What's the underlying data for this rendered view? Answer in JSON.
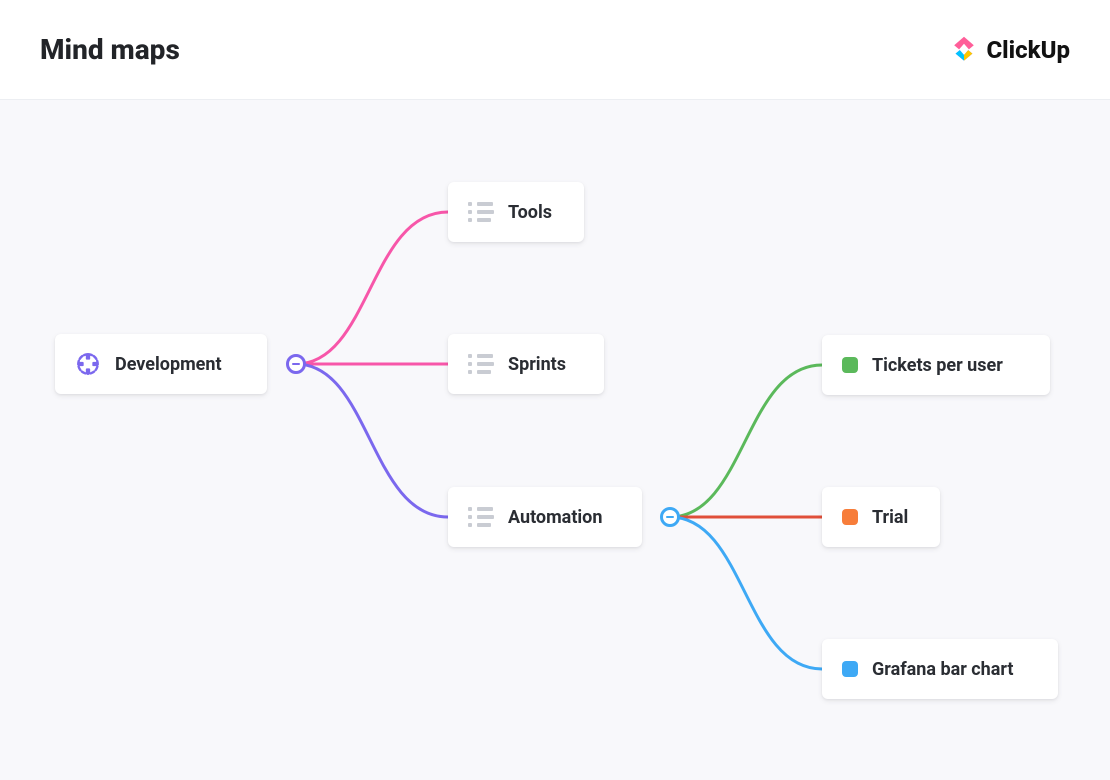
{
  "header": {
    "title": "Mind maps",
    "brand": "ClickUp"
  },
  "colors": {
    "purple": "#7b68ee",
    "pink": "#f756a9",
    "blue": "#3ea9f5",
    "green": "#5bb95b",
    "red": "#e04f3a",
    "orange": "#f77d3a"
  },
  "nodes": {
    "root": {
      "label": "Development",
      "icon": "globe-icon"
    },
    "level1": [
      {
        "id": "tools",
        "label": "Tools",
        "icon": "list-icon"
      },
      {
        "id": "sprints",
        "label": "Sprints",
        "icon": "list-icon"
      },
      {
        "id": "automation",
        "label": "Automation",
        "icon": "list-icon"
      }
    ],
    "level2": [
      {
        "id": "tickets",
        "label": "Tickets per user",
        "bullet_color": "#5bb95b"
      },
      {
        "id": "trial",
        "label": "Trial",
        "bullet_color": "#f77d3a"
      },
      {
        "id": "grafana",
        "label": "Grafana bar chart",
        "bullet_color": "#3ea9f5"
      }
    ]
  }
}
